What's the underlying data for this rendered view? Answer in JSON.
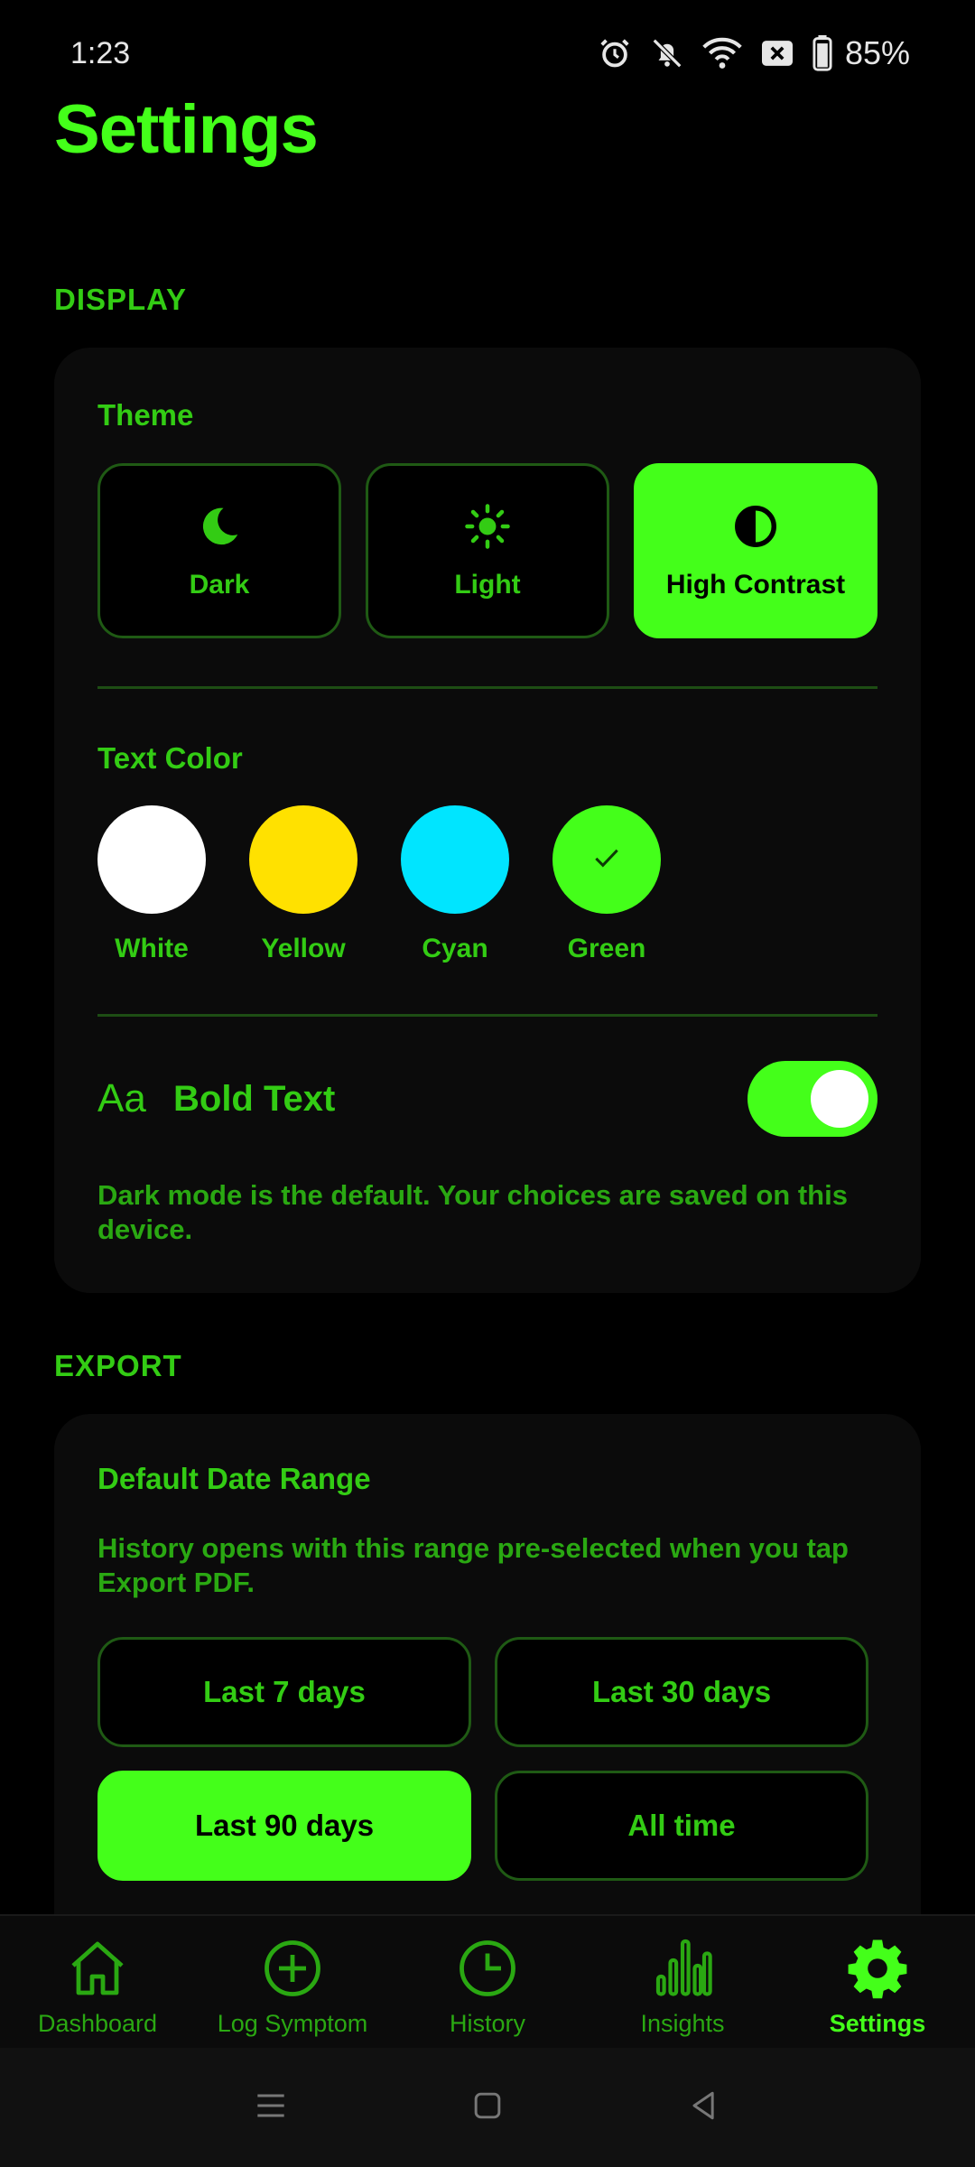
{
  "status_bar": {
    "time": "1:23",
    "battery": "85%",
    "icons": [
      "alarm-icon",
      "bell-off-icon",
      "wifi-icon",
      "x-box-icon",
      "battery-icon"
    ]
  },
  "page": {
    "title": "Settings"
  },
  "display": {
    "section_label": "DISPLAY",
    "theme_label": "Theme",
    "themes": [
      {
        "label": "Dark",
        "icon": "moon-icon",
        "selected": false
      },
      {
        "label": "Light",
        "icon": "sun-icon",
        "selected": false
      },
      {
        "label": "High Contrast",
        "icon": "contrast-icon",
        "selected": true
      }
    ],
    "text_color_label": "Text Color",
    "text_colors": [
      {
        "label": "White",
        "color": "#ffffff",
        "selected": false
      },
      {
        "label": "Yellow",
        "color": "#ffe100",
        "selected": false
      },
      {
        "label": "Cyan",
        "color": "#00e5ff",
        "selected": false
      },
      {
        "label": "Green",
        "color": "#44ff1a",
        "selected": true
      }
    ],
    "bold_text": {
      "icon_text": "Aa",
      "label": "Bold Text",
      "enabled": true
    },
    "note": "Dark mode is the default. Your choices are saved on this device."
  },
  "export": {
    "section_label": "EXPORT",
    "range_label": "Default Date Range",
    "range_description": "History opens with this range pre-selected when you tap Export PDF.",
    "ranges": [
      {
        "label": "Last 7 days",
        "selected": false
      },
      {
        "label": "Last 30 days",
        "selected": false
      },
      {
        "label": "Last 90 days",
        "selected": true
      },
      {
        "label": "All time",
        "selected": false
      }
    ]
  },
  "bottom_nav": [
    {
      "label": "Dashboard",
      "icon": "home-icon",
      "active": false
    },
    {
      "label": "Log Symptom",
      "icon": "plus-circle-icon",
      "active": false
    },
    {
      "label": "History",
      "icon": "clock-icon",
      "active": false
    },
    {
      "label": "Insights",
      "icon": "bar-chart-icon",
      "active": false
    },
    {
      "label": "Settings",
      "icon": "gear-icon",
      "active": true
    }
  ],
  "colors": {
    "accent": "#44ff1a",
    "text_green": "#33cc14",
    "card_bg": "#0b0b0b",
    "background": "#000000"
  }
}
